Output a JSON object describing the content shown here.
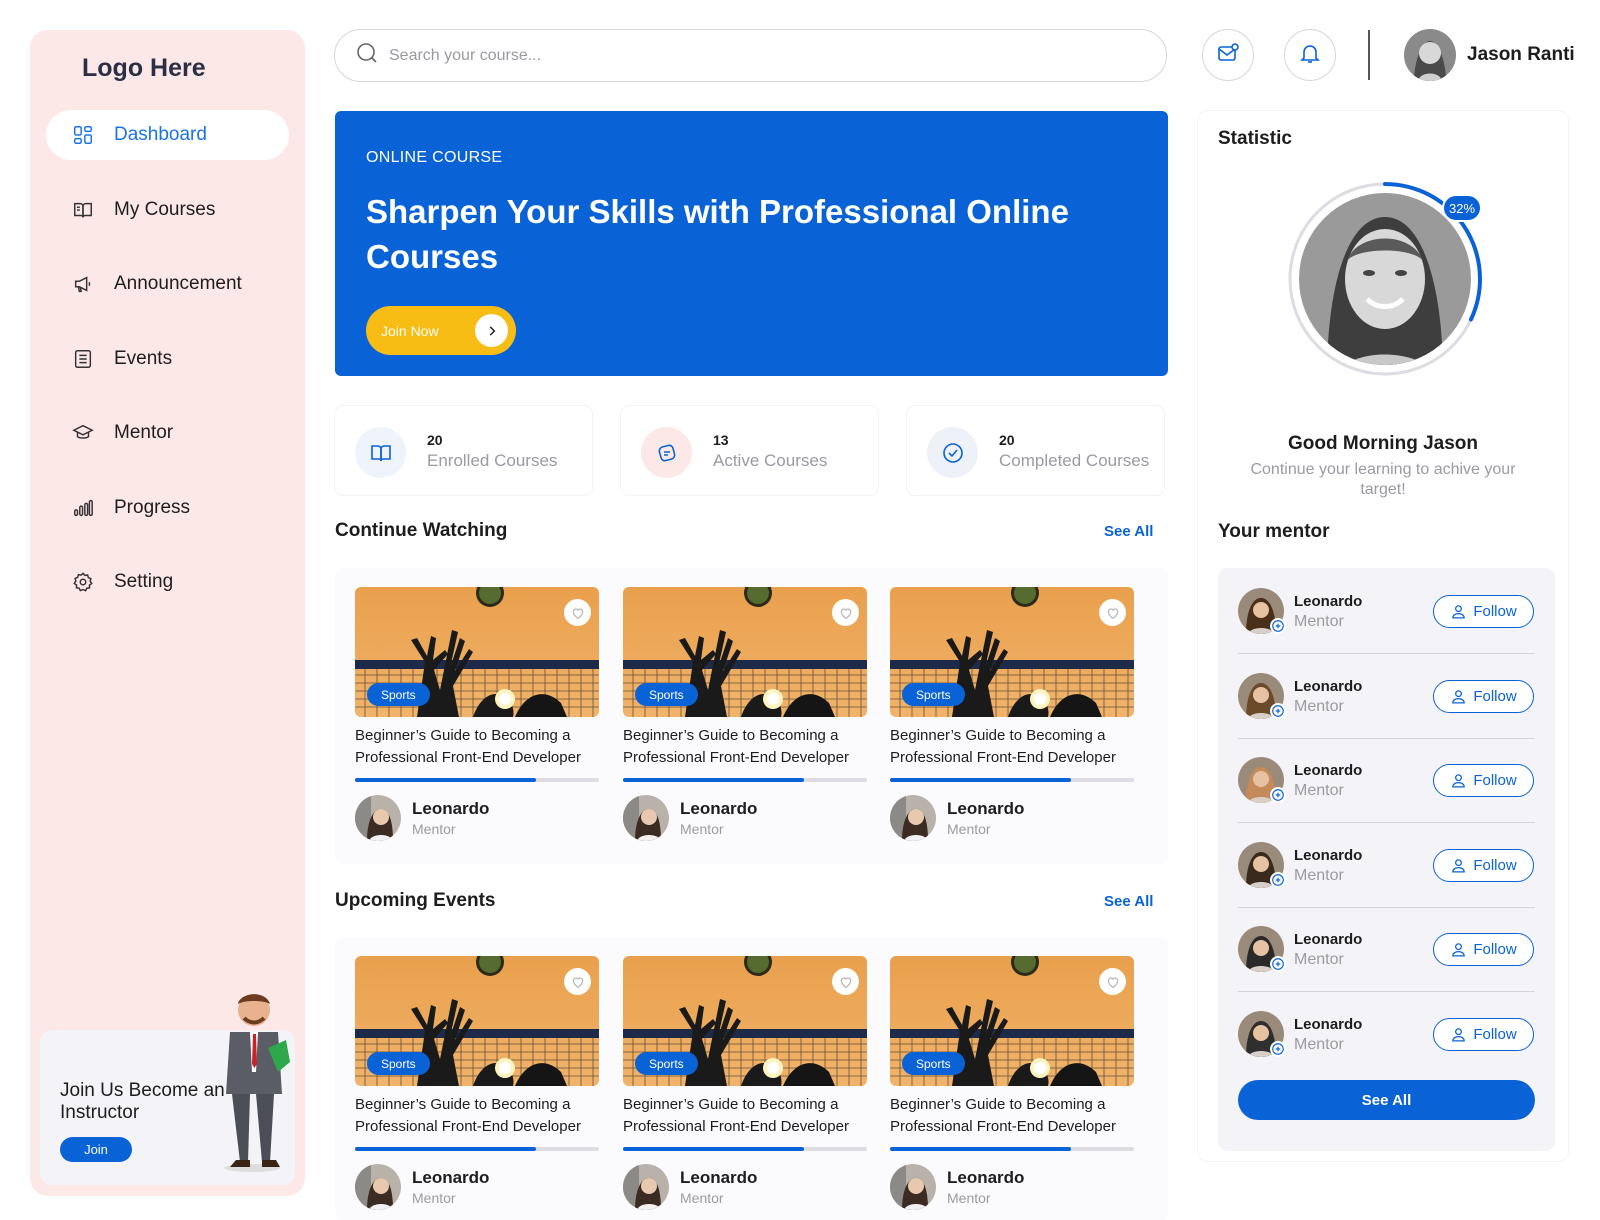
{
  "sidebar": {
    "logo": "Logo Here",
    "items": [
      {
        "label": "Dashboard",
        "icon": "dashboard-icon",
        "active": true
      },
      {
        "label": "My Courses",
        "icon": "book-icon"
      },
      {
        "label": "Announcement",
        "icon": "megaphone-icon"
      },
      {
        "label": "Events",
        "icon": "list-icon"
      },
      {
        "label": "Mentor",
        "icon": "graduation-cap-icon"
      },
      {
        "label": "Progress",
        "icon": "bar-chart-icon"
      },
      {
        "label": "Setting",
        "icon": "gear-icon"
      }
    ],
    "promo": {
      "text": "Join Us Become an Instructor",
      "button": "Join"
    }
  },
  "header": {
    "search_placeholder": "Search your course...",
    "user_name": "Jason Ranti"
  },
  "hero": {
    "kicker": "ONLINE COURSE",
    "title": "Sharpen Your Skills with Professional Online Courses",
    "button": "Join Now"
  },
  "stats": [
    {
      "value": "20",
      "label": "Enrolled Courses"
    },
    {
      "value": "13",
      "label": "Active Courses"
    },
    {
      "value": "20",
      "label": "Completed Courses"
    }
  ],
  "continue_watching": {
    "title": "Continue Watching",
    "see_all": "See All",
    "cards": [
      {
        "tag": "Sports",
        "title": "Beginner’s Guide to Becoming a Professional Front-End Developer",
        "progress": 0.74,
        "mentor": "Leonardo",
        "role": "Mentor"
      },
      {
        "tag": "Sports",
        "title": "Beginner’s Guide to Becoming a Professional Front-End Developer",
        "progress": 0.74,
        "mentor": "Leonardo",
        "role": "Mentor"
      },
      {
        "tag": "Sports",
        "title": "Beginner’s Guide to Becoming a Professional Front-End Developer",
        "progress": 0.74,
        "mentor": "Leonardo",
        "role": "Mentor"
      }
    ]
  },
  "upcoming_events": {
    "title": "Upcoming Events",
    "see_all": "See All",
    "cards": [
      {
        "tag": "Sports",
        "title": "Beginner’s Guide to Becoming a Professional Front-End Developer",
        "progress": 0.74,
        "mentor": "Leonardo",
        "role": "Mentor"
      },
      {
        "tag": "Sports",
        "title": "Beginner’s Guide to Becoming a Professional Front-End Developer",
        "progress": 0.74,
        "mentor": "Leonardo",
        "role": "Mentor"
      },
      {
        "tag": "Sports",
        "title": "Beginner’s Guide to Becoming a Professional Front-End Developer",
        "progress": 0.74,
        "mentor": "Leonardo",
        "role": "Mentor"
      }
    ]
  },
  "statistic": {
    "title": "Statistic",
    "percent": "32%",
    "progress": 0.32,
    "greeting": "Good Morning Jason",
    "subtext": "Continue your learning to achive your target!"
  },
  "mentors": {
    "title": "Your mentor",
    "list": [
      {
        "name": "Leonardo",
        "role": "Mentor",
        "button": "Follow"
      },
      {
        "name": "Leonardo",
        "role": "Mentor",
        "button": "Follow"
      },
      {
        "name": "Leonardo",
        "role": "Mentor",
        "button": "Follow"
      },
      {
        "name": "Leonardo",
        "role": "Mentor",
        "button": "Follow"
      },
      {
        "name": "Leonardo",
        "role": "Mentor",
        "button": "Follow"
      },
      {
        "name": "Leonardo",
        "role": "Mentor",
        "button": "Follow"
      }
    ],
    "see_all": "See All"
  },
  "colors": {
    "primary": "#0a63d6",
    "accent": "#f7bd14",
    "sidebar_bg": "#fde8e8"
  }
}
